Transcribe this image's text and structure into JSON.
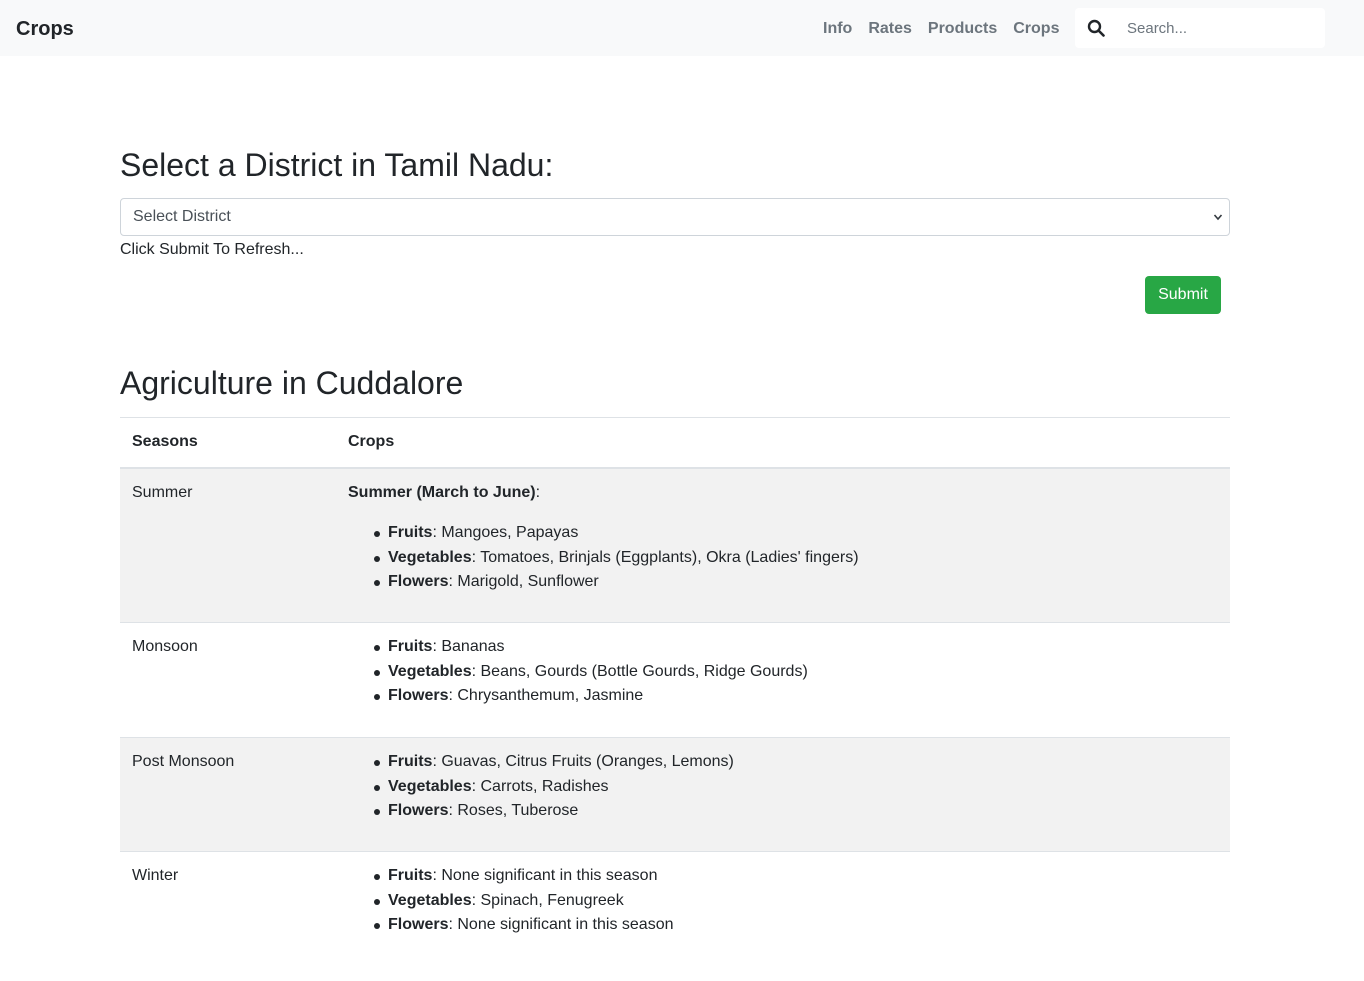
{
  "navbar": {
    "brand": "Crops",
    "links": [
      "Info",
      "Rates",
      "Products",
      "Crops"
    ],
    "search_placeholder": "Search..."
  },
  "form": {
    "heading": "Select a District in Tamil Nadu:",
    "select_value": "Select District",
    "hint": "Click Submit To Refresh...",
    "submit_label": "Submit"
  },
  "agriculture": {
    "heading": "Agriculture in Cuddalore",
    "columns": [
      "Seasons",
      "Crops"
    ],
    "rows": [
      {
        "season": "Summer",
        "intro": "Summer (March to June)",
        "items": [
          {
            "label": "Fruits",
            "value": ": Mangoes, Papayas"
          },
          {
            "label": "Vegetables",
            "value": ": Tomatoes, Brinjals (Eggplants), Okra (Ladies' fingers)"
          },
          {
            "label": "Flowers",
            "value": ": Marigold, Sunflower"
          }
        ]
      },
      {
        "season": "Monsoon",
        "items": [
          {
            "label": "Fruits",
            "value": ": Bananas"
          },
          {
            "label": "Vegetables",
            "value": ": Beans, Gourds (Bottle Gourds, Ridge Gourds)"
          },
          {
            "label": "Flowers",
            "value": ": Chrysanthemum, Jasmine"
          }
        ]
      },
      {
        "season": "Post Monsoon",
        "items": [
          {
            "label": "Fruits",
            "value": ": Guavas, Citrus Fruits (Oranges, Lemons)"
          },
          {
            "label": "Vegetables",
            "value": ": Carrots, Radishes"
          },
          {
            "label": "Flowers",
            "value": ": Roses, Tuberose"
          }
        ]
      },
      {
        "season": "Winter",
        "items": [
          {
            "label": "Fruits",
            "value": ": None significant in this season"
          },
          {
            "label": "Vegetables",
            "value": ": Spinach, Fenugreek"
          },
          {
            "label": "Flowers",
            "value": ": None significant in this season"
          }
        ]
      }
    ]
  },
  "colors": {
    "navbar_bg": "#f8f9fa",
    "nav_link": "#6c757d",
    "submit_bg": "#28a745",
    "stripe_bg": "#f2f2f2"
  }
}
